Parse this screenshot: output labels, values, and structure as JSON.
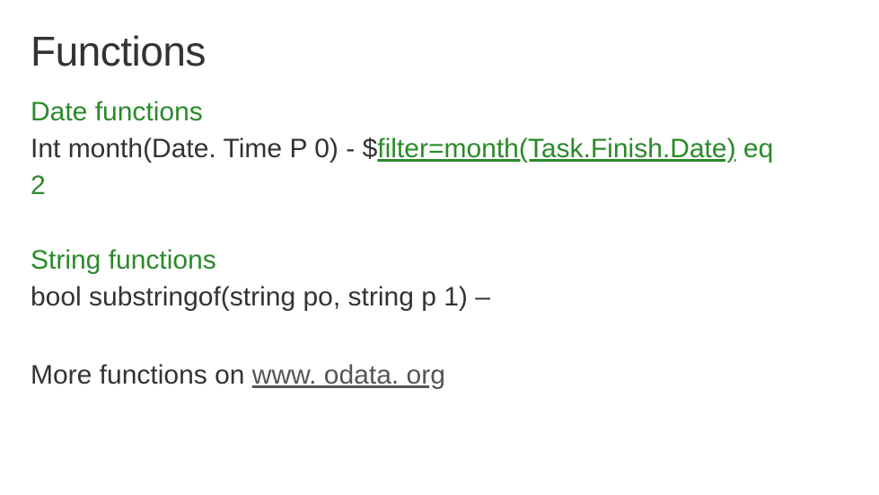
{
  "title": "Functions",
  "section1": {
    "heading": "Date functions",
    "line_prefix": "Int month(Date. Time P 0) - $",
    "link_text": "filter=month(Task.Finish.Date)",
    "suffix1": " eq",
    "suffix2": "2"
  },
  "section2": {
    "heading": "String functions",
    "line": "bool substringof(string po, string p 1) –"
  },
  "footer": {
    "prefix": "More functions on ",
    "link": "www. odata. org"
  }
}
